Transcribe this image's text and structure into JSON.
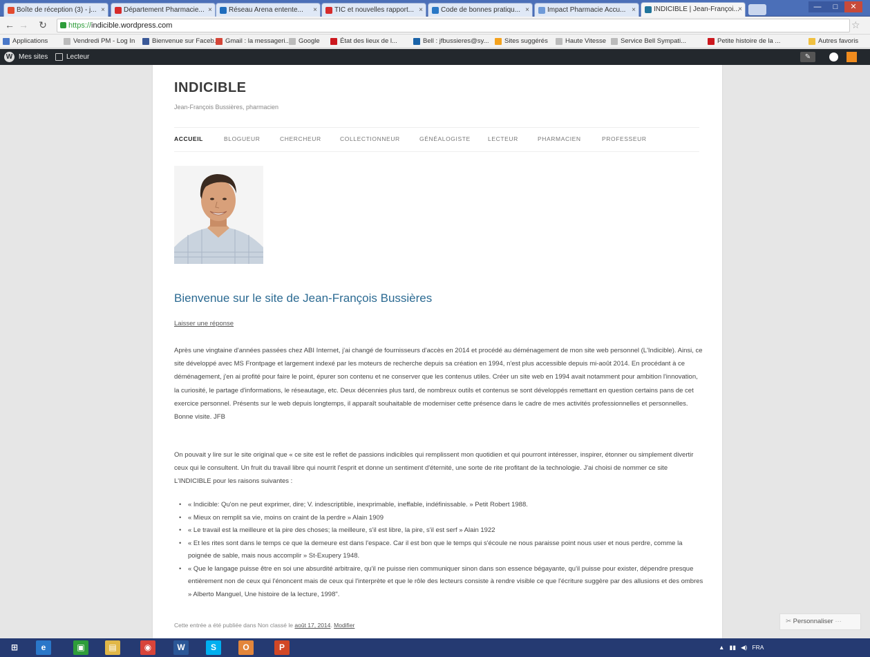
{
  "browser": {
    "tabs": [
      {
        "label": "Boîte de réception (3) - j...",
        "color": "#e34b2f"
      },
      {
        "label": "Département Pharmacie...",
        "color": "#d62b2b"
      },
      {
        "label": "Réseau Arena entente...",
        "color": "#1f6dbd"
      },
      {
        "label": "TIC et nouvelles rapport...",
        "color": "#d62b2b"
      },
      {
        "label": "Code de bonnes pratiqu...",
        "color": "#2a78c5"
      },
      {
        "label": "Impact Pharmacie Accu...",
        "color": "#6e9ad8"
      },
      {
        "label": "INDICIBLE | Jean-Françoi...",
        "color": "#21759b"
      }
    ],
    "url_scheme": "https://",
    "url_host": "indicible.wordpress.com",
    "bookmarks": [
      {
        "label": "Applications",
        "color": "#4a78c8"
      },
      {
        "label": "Vendredi PM - Log In",
        "color": "#bbbbbb"
      },
      {
        "label": "Bienvenue sur Faceb...",
        "color": "#3b5998"
      },
      {
        "label": "Gmail : la messageri...",
        "color": "#d44638"
      },
      {
        "label": "Google",
        "color": "#bbbbbb"
      },
      {
        "label": "État des lieux de l...",
        "color": "#cc181e"
      },
      {
        "label": "Bell : jfbussieres@sy...",
        "color": "#1a63a8"
      },
      {
        "label": "Sites suggérés",
        "color": "#f4a21d"
      },
      {
        "label": "Haute Vitesse",
        "color": "#bbbbbb"
      },
      {
        "label": "Service Bell Sympati...",
        "color": "#bbbbbb"
      },
      {
        "label": "Petite histoire de la ...",
        "color": "#cc181e"
      },
      {
        "label": "Autres favoris",
        "color": "#f0c040"
      }
    ]
  },
  "wpbar": {
    "my_sites": "Mes sites",
    "reader": "Lecteur"
  },
  "site": {
    "title": "INDICIBLE",
    "description": "Jean-François Bussières, pharmacien",
    "nav": [
      "ACCUEIL",
      "BLOGUEUR",
      "CHERCHEUR",
      "COLLECTIONNEUR",
      "GÉNÉALOGISTE",
      "LECTEUR",
      "PHARMACIEN",
      "PROFESSEUR"
    ]
  },
  "post": {
    "title": "Bienvenue sur le site de Jean-François Bussières",
    "reply": "Laisser une réponse",
    "para1": "Après une vingtaine d'années passées chez ABI Internet, j'ai changé de fournisseurs d'accès en 2014 et procédé au déménagement de mon site web personnel (L'Indicible). Ainsi, ce site développé avec MS Frontpage et largement indexé par les moteurs de recherche depuis sa création en 1994, n'est plus accessible depuis mi-août 2014. En procédant à ce déménagement, j'en ai profité pour faire le point, épurer son contenu et ne conserver que les contenus utiles. Créer un site web en 1994 avait notamment pour ambition l'innovation, la curiosité, le partage d'informations, le réseautage, etc. Deux décennies plus tard, de nombreux outils et contenus se sont développés remettant en question certains pans de cet exercice personnel. Présents sur le web depuis longtemps, il apparaît souhaitable de moderniser cette présence dans le cadre de mes activités professionnelles et personnelles. Bonne visite. JFB",
    "para2": "On pouvait y lire sur le site original que « ce site est le reflet de passions indicibles qui remplissent mon quotidien et qui pourront intéresser, inspirer, étonner ou simplement divertir ceux qui le consultent. Un fruit du travail libre qui nourrit l'esprit et donne un sentiment d'éternité, une sorte de rite profitant de la technologie. J'ai choisi de nommer ce site L'INDICIBLE pour les raisons suivantes :",
    "quotes": [
      "« Indicible: Qu'on ne peut exprimer, dire; V. indescriptible, inexprimable, ineffable, indéfinissable. » Petit Robert 1988.",
      "« Mieux on remplit sa vie, moins on craint de la perdre » Alain 1909",
      "« Le travail est la meilleure et la pire des choses; la meilleure, s'il est libre, la pire, s'il est serf » Alain 1922",
      "« Et les rites sont dans le temps ce que la demeure est dans l'espace. Car il est bon que le temps qui s'écoule ne nous paraisse point nous user et nous perdre, comme la poignée de sable, mais nous accomplir » St-Exupery 1948.",
      "« Que le langage puisse être en soi une absurdité arbitraire, qu'il ne puisse rien communiquer sinon dans son essence bégayante, qu'il puisse pour exister, dépendre presque entièrement non de ceux qui l'énoncent mais de ceux qui l'interprète et que le rôle des lecteurs consiste à rendre visible ce que l'écriture suggère par des allusions et des ombres » Alberto Manguel, Une histoire de la lecture, 1998\"."
    ],
    "meta_prefix": "Cette entrée a été publiée dans Non classé le",
    "meta_date": "août 17, 2014",
    "meta_sep": ".",
    "meta_edit": "Modifier"
  },
  "customize_label": "Personnaliser",
  "taskbar": {
    "apps": [
      {
        "icon": "windows-start-icon",
        "glyph": "⊞",
        "color": "#253a72"
      },
      {
        "icon": "internet-explorer-icon",
        "glyph": "e",
        "color": "#2a77c9"
      },
      {
        "icon": "store-icon",
        "glyph": "▣",
        "color": "#2e9d3a"
      },
      {
        "icon": "file-explorer-icon",
        "glyph": "▤",
        "color": "#e1b748"
      },
      {
        "icon": "chrome-icon",
        "glyph": "◉",
        "color": "#d8443a"
      },
      {
        "icon": "word-icon",
        "glyph": "W",
        "color": "#2b5797"
      },
      {
        "icon": "skype-icon",
        "glyph": "S",
        "color": "#00aff0"
      },
      {
        "icon": "outlook-icon",
        "glyph": "O",
        "color": "#e3863b"
      },
      {
        "icon": "powerpoint-icon",
        "glyph": "P",
        "color": "#d24726"
      }
    ],
    "tray_lang": "FRA"
  }
}
